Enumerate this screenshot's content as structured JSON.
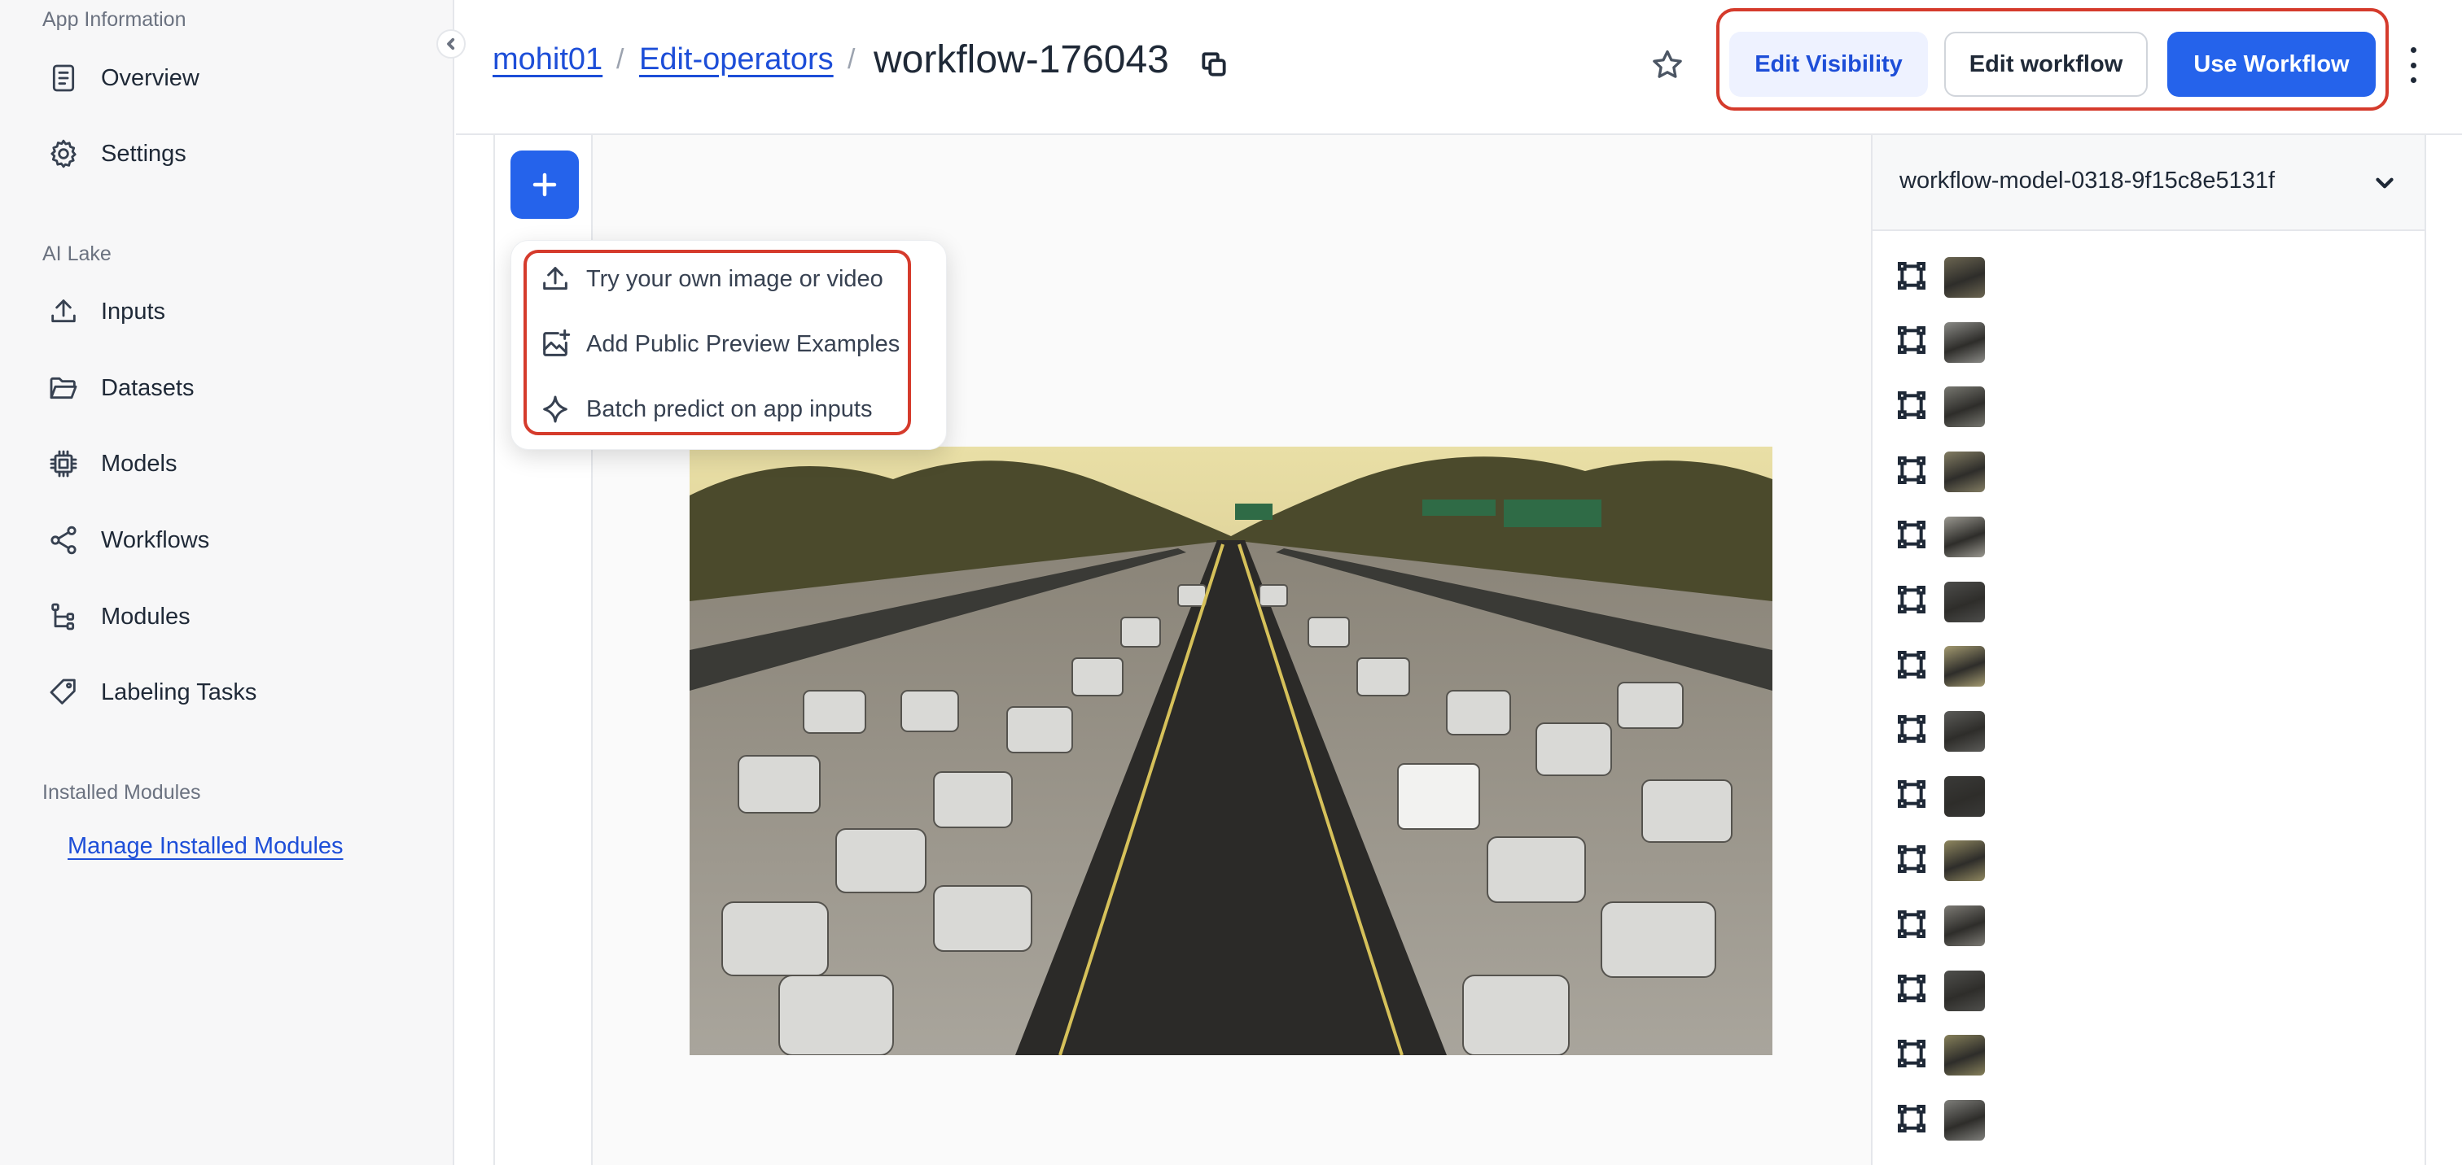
{
  "sidebar": {
    "section_app": "App Information",
    "app_items": [
      {
        "label": "Overview",
        "icon": "document-icon"
      },
      {
        "label": "Settings",
        "icon": "gear-icon"
      }
    ],
    "section_lake": "AI Lake",
    "lake_items": [
      {
        "label": "Inputs",
        "icon": "upload-icon"
      },
      {
        "label": "Datasets",
        "icon": "folder-icon"
      },
      {
        "label": "Models",
        "icon": "chip-icon"
      },
      {
        "label": "Workflows",
        "icon": "share-nodes-icon"
      },
      {
        "label": "Modules",
        "icon": "branch-icon"
      },
      {
        "label": "Labeling Tasks",
        "icon": "tag-icon"
      }
    ],
    "section_modules": "Installed Modules",
    "manage_link": "Manage Installed Modules"
  },
  "header": {
    "breadcrumb": [
      "mohit01",
      "Edit-operators"
    ],
    "separator": "/",
    "title": "workflow-176043",
    "actions": {
      "edit_visibility": "Edit Visibility",
      "edit_workflow": "Edit workflow",
      "use_workflow": "Use Workflow"
    }
  },
  "add_menu": {
    "items": [
      {
        "label": "Try your own image or video",
        "icon": "upload-icon"
      },
      {
        "label": "Add Public Preview Examples",
        "icon": "image-add-icon"
      },
      {
        "label": "Batch predict on app inputs",
        "icon": "sparkle-icon"
      }
    ]
  },
  "right_panel": {
    "selected_model": "workflow-model-0318-9f15c8e5131f",
    "annotation_rows": 14
  },
  "colors": {
    "primary": "#2563eb",
    "link": "#1d4ed8",
    "highlight": "#d53b2c"
  }
}
